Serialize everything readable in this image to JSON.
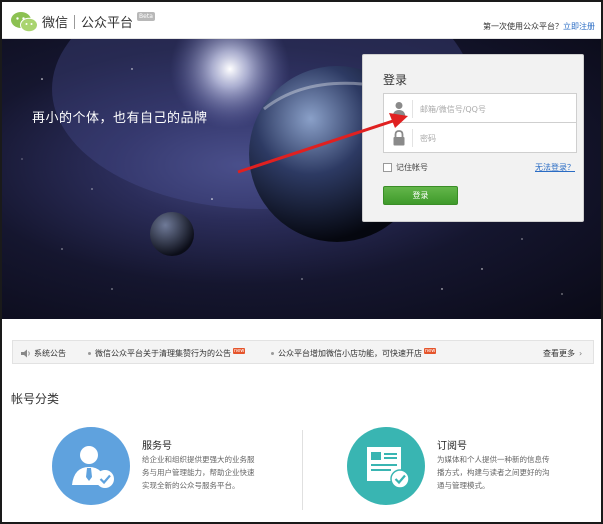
{
  "header": {
    "brand_name": "微信",
    "brand_sub": "公众平台",
    "beta_badge": "Beta",
    "first_time_text": "第一次使用公众平台？",
    "register_link": "立即注册"
  },
  "hero": {
    "slogan": "再小的个体，也有自己的品牌"
  },
  "login": {
    "title": "登录",
    "account_placeholder": "邮箱/微信号/QQ号",
    "password_placeholder": "密码",
    "remember_label": "记住帐号",
    "forgot_link": "无法登录？",
    "submit_label": "登录"
  },
  "notice": {
    "label": "系统公告",
    "items": [
      {
        "text": "微信公众平台关于清理集赞行为的公告",
        "badge": "new"
      },
      {
        "text": "公众平台增加微信小店功能，可快速开店",
        "badge": "new"
      }
    ],
    "more": "查看更多"
  },
  "accounts": {
    "title": "帐号分类",
    "types": [
      {
        "name": "服务号",
        "lines": [
          "给企业和组织提供更强大的业务服",
          "务与用户管理能力，帮助企业快速",
          "实现全新的公众号服务平台。"
        ]
      },
      {
        "name": "订阅号",
        "lines": [
          "为媒体和个人提供一种新的信息传",
          "播方式，构建与读者之间更好的沟",
          "通与管理模式。"
        ]
      }
    ]
  },
  "colors": {
    "link_blue": "#2a6cc4",
    "login_green": "#4aa535",
    "service_blue": "#5fa2de",
    "subscribe_teal": "#39b5b2",
    "arrow_red": "#e02020"
  }
}
